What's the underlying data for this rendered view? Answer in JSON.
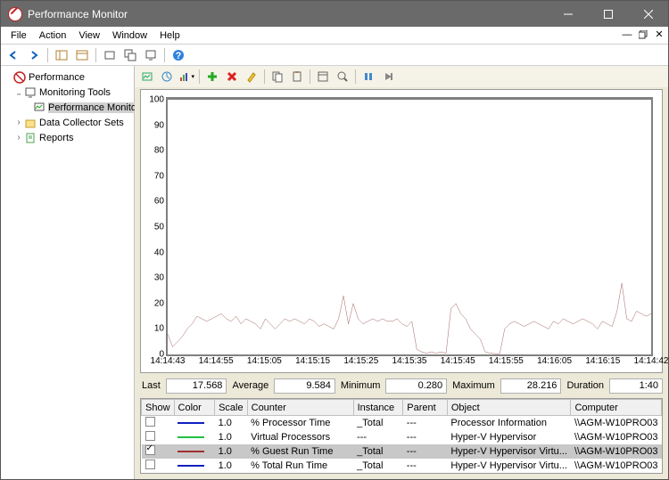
{
  "title": "Performance Monitor",
  "menus": [
    "File",
    "Action",
    "View",
    "Window",
    "Help"
  ],
  "nav": {
    "root": "Performance",
    "items": [
      "Monitoring Tools",
      "Performance Monitor",
      "Data Collector Sets",
      "Reports"
    ]
  },
  "stats": {
    "last_label": "Last",
    "last": "17.568",
    "avg_label": "Average",
    "avg": "9.584",
    "min_label": "Minimum",
    "min": "0.280",
    "max_label": "Maximum",
    "max": "28.216",
    "dur_label": "Duration",
    "dur": "1:40"
  },
  "table": {
    "headers": [
      "Show",
      "Color",
      "Scale",
      "Counter",
      "Instance",
      "Parent",
      "Object",
      "Computer"
    ],
    "rows": [
      {
        "show": false,
        "color": "#1020c0",
        "scale": "1.0",
        "counter": "% Processor Time",
        "instance": "_Total",
        "parent": "---",
        "object": "Processor Information",
        "computer": "\\\\AGM-W10PRO03"
      },
      {
        "show": false,
        "color": "#20c040",
        "scale": "1.0",
        "counter": "Virtual Processors",
        "instance": "---",
        "parent": "---",
        "object": "Hyper-V Hypervisor",
        "computer": "\\\\AGM-W10PRO03"
      },
      {
        "show": true,
        "color": "#a03030",
        "scale": "1.0",
        "counter": "% Guest Run Time",
        "instance": "_Total",
        "parent": "---",
        "object": "Hyper-V Hypervisor Virtu...",
        "computer": "\\\\AGM-W10PRO03",
        "selected": true
      },
      {
        "show": false,
        "color": "#1020c0",
        "scale": "1.0",
        "counter": "% Total Run Time",
        "instance": "_Total",
        "parent": "---",
        "object": "Hyper-V Hypervisor Virtu...",
        "computer": "\\\\AGM-W10PRO03"
      }
    ]
  },
  "chart_data": {
    "type": "line",
    "ylim": [
      0,
      100
    ],
    "yticks": [
      0,
      10,
      20,
      30,
      40,
      50,
      60,
      70,
      80,
      90,
      100
    ],
    "xlabels": [
      "14:14:43",
      "14:14:55",
      "14:15:05",
      "14:15:15",
      "14:15:25",
      "14:15:35",
      "14:15:45",
      "14:15:55",
      "14:16:05",
      "14:16:15",
      "14:14:42"
    ],
    "series": [
      {
        "name": "% Guest Run Time",
        "color": "#8b3a3a",
        "values": [
          8,
          3,
          5,
          7,
          10,
          12,
          15,
          14,
          13,
          14,
          15,
          16,
          14,
          13,
          15,
          12,
          14,
          13,
          12,
          10,
          14,
          12,
          10,
          12,
          14,
          13,
          14,
          13,
          12,
          14,
          13,
          11,
          12,
          11,
          10,
          14,
          23,
          12,
          20,
          14,
          12,
          13,
          14,
          13,
          14,
          13,
          13,
          14,
          12,
          11,
          13,
          2,
          1,
          0.5,
          1,
          0.5,
          1,
          0.5,
          18,
          20,
          16,
          14,
          10,
          8,
          6,
          1,
          0.5,
          0.3,
          0.3,
          10,
          12,
          13,
          12,
          11,
          12,
          13,
          12,
          11,
          10,
          13,
          12,
          14,
          13,
          12,
          13,
          14,
          13,
          12,
          10,
          13,
          12,
          11,
          17,
          28,
          14,
          13,
          17,
          16,
          15,
          16
        ]
      }
    ]
  }
}
